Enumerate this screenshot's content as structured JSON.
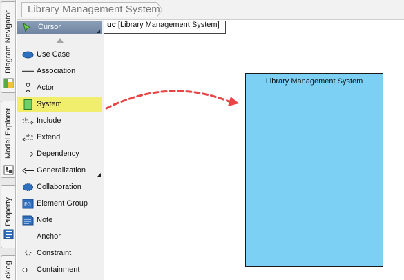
{
  "breadcrumb": {
    "title": "Library Management System"
  },
  "side_tabs": [
    {
      "label": "Diagram Navigator"
    },
    {
      "label": "Model Explorer"
    },
    {
      "label": "Property"
    },
    {
      "label": "cklog"
    }
  ],
  "palette": {
    "cursor_label": "Cursor",
    "items": [
      {
        "label": "Use Case",
        "icon": "use-case-icon"
      },
      {
        "label": "Association",
        "icon": "association-icon"
      },
      {
        "label": "Actor",
        "icon": "actor-icon"
      },
      {
        "label": "System",
        "icon": "system-icon"
      },
      {
        "label": "Include",
        "icon": "include-icon"
      },
      {
        "label": "Extend",
        "icon": "extend-icon"
      },
      {
        "label": "Dependency",
        "icon": "dependency-icon"
      },
      {
        "label": "Generalization",
        "icon": "generalization-icon"
      },
      {
        "label": "Collaboration",
        "icon": "collaboration-icon"
      },
      {
        "label": "Element Group",
        "icon": "element-group-icon"
      },
      {
        "label": "Note",
        "icon": "note-icon"
      },
      {
        "label": "Anchor",
        "icon": "anchor-icon"
      },
      {
        "label": "Constraint",
        "icon": "constraint-icon"
      },
      {
        "label": "Containment",
        "icon": "containment-icon"
      }
    ],
    "selected_item": "System",
    "element_group_icon_text": "EG"
  },
  "diagram": {
    "tab_prefix": "uc",
    "tab_name": "[Library Management System]",
    "system_title": "Library Management System"
  },
  "colors": {
    "selected_highlight": "#f1ee6e",
    "system_fill": "#7cd0f4",
    "annotation_arrow": "#e84545"
  }
}
